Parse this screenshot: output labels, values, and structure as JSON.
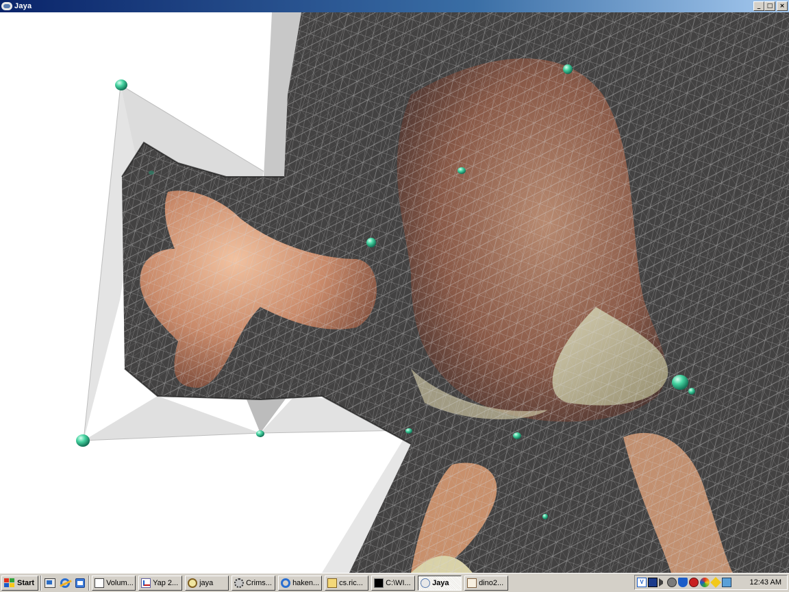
{
  "window": {
    "title": "Jaya",
    "controls": {
      "minimize": "_",
      "maximize": "□",
      "close": "×"
    }
  },
  "taskbar": {
    "start_label": "Start",
    "quick_launch": [
      {
        "icon": "show-desktop-icon"
      },
      {
        "icon": "internet-explorer-icon"
      },
      {
        "icon": "outlook-express-icon"
      }
    ],
    "tasks": [
      {
        "label": "Volum...",
        "icon": "document-icon",
        "active": false
      },
      {
        "label": "Yap 2...",
        "icon": "chart-icon",
        "active": false
      },
      {
        "label": "jaya",
        "icon": "search-folder-icon",
        "active": false
      },
      {
        "label": "Crims...",
        "icon": "gear-icon",
        "active": false
      },
      {
        "label": "haken...",
        "icon": "internet-explorer-icon",
        "active": false
      },
      {
        "label": "cs.ric...",
        "icon": "network-folder-icon",
        "active": false
      },
      {
        "label": "C:\\WI...",
        "icon": "command-prompt-icon",
        "active": false
      },
      {
        "label": "Jaya",
        "icon": "jaya-app-icon",
        "active": true
      },
      {
        "label": "dino2...",
        "icon": "image-icon",
        "active": false
      }
    ],
    "tray": {
      "icons": [
        "vc-icon",
        "network-icon",
        "speaker-icon",
        "settings-icon",
        "shield-icon",
        "antivirus-icon",
        "color-icon",
        "pencil-icon",
        "monitor-icon"
      ],
      "clock": "12:43 AM"
    }
  }
}
